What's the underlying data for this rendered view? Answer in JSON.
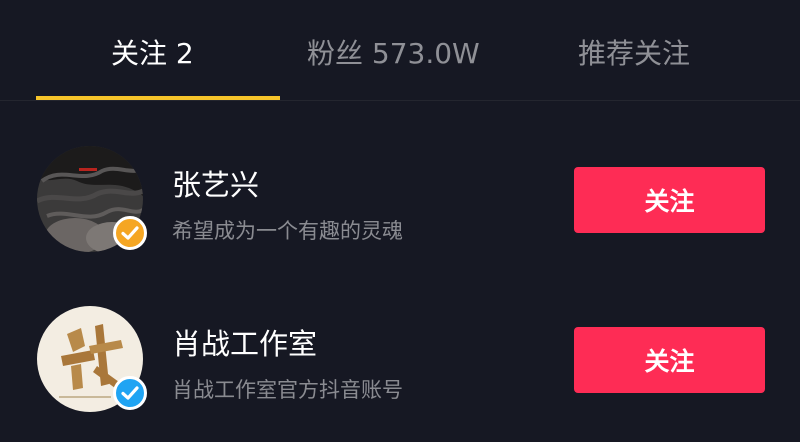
{
  "tabs": [
    {
      "label": "关注 2",
      "active": true
    },
    {
      "label": "粉丝 573.0W",
      "active": false
    },
    {
      "label": "推荐关注",
      "active": false
    }
  ],
  "users": [
    {
      "name": "张艺兴",
      "bio": "希望成为一个有趣的灵魂",
      "follow_label": "关注",
      "badge_color": "#f5a623",
      "badge_icon": "verified-check-icon"
    },
    {
      "name": "肖战工作室",
      "bio": "肖战工作室官方抖音账号",
      "follow_label": "关注",
      "badge_color": "#20a4f3",
      "badge_icon": "verified-check-icon"
    }
  ],
  "colors": {
    "background": "#161823",
    "accent_underline": "#f6c42a",
    "follow_button": "#fe2c55"
  }
}
